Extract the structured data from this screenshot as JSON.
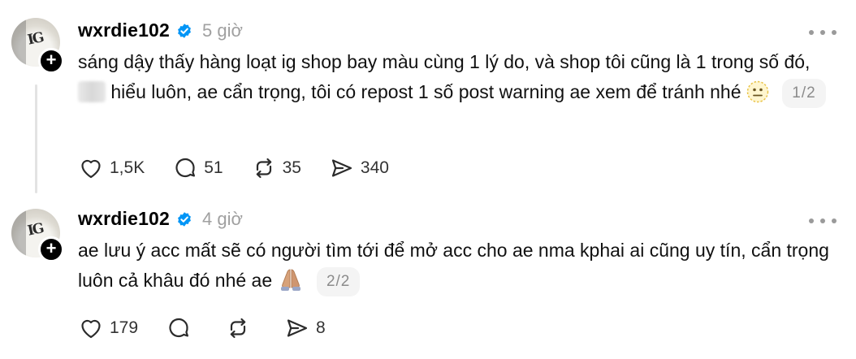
{
  "posts": [
    {
      "username": "wxrdie102",
      "time": "5 giờ",
      "text_a": "sáng dậy thấy hàng loạt ig shop bay màu cùng 1 lý do, và shop tôi cũng là 1 trong số đó,",
      "text_b": "hiểu luôn, ae cẩn trọng, tôi có repost 1 số post warning ae xem để tránh nhé",
      "emoji": "neutral-face-emoji",
      "page": "1/2",
      "likes": "1,5K",
      "comments": "51",
      "reposts": "35",
      "shares": "340"
    },
    {
      "username": "wxrdie102",
      "time": "4 giờ",
      "text_a": "ae lưu ý acc mất sẽ có người tìm tới để mở acc cho ae nma kphai ai cũng uy tín, cẩn trọng luôn cả khâu đó nhé ae",
      "emoji": "folded-hands-emoji",
      "page": "2/2",
      "likes": "179",
      "comments": "",
      "reposts": "",
      "shares": "8"
    }
  ],
  "colors": {
    "verified": "#0095f6",
    "muted": "#a0a0a0",
    "icon": "#2b2b2b"
  }
}
